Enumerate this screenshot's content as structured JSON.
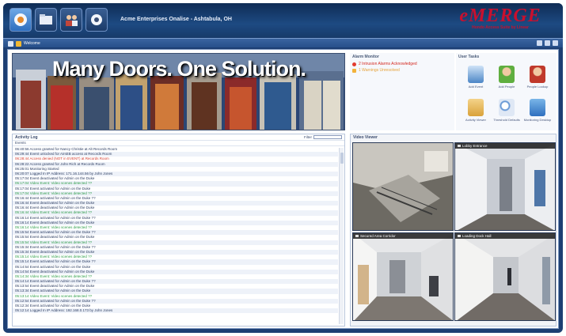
{
  "header": {
    "site_title": "Acme Enterprises Onalise - Ashtabula, OH",
    "nav_buttons": [
      {
        "name": "home-icon"
      },
      {
        "name": "folder-icon"
      },
      {
        "name": "people-icon"
      },
      {
        "name": "gear-icon"
      }
    ],
    "logo": {
      "main": "eMERGE",
      "sub": "Hondo Access Suite by Linear"
    }
  },
  "toolbar": {
    "welcome_label": "Welcome"
  },
  "banner": {
    "text": "Many Doors. One Solution."
  },
  "alarm_monitor": {
    "title": "Alarm Monitor",
    "items": [
      {
        "text": "2 Intrusion Alarms Acknowledged",
        "status": "alarm"
      },
      {
        "text": "1 Warnings Unresolved",
        "status": "warning"
      }
    ]
  },
  "user_tasks": {
    "title": "User Tasks",
    "items": [
      {
        "label": "Add Event",
        "icon": "calendar-icon"
      },
      {
        "label": "Add People",
        "icon": "add-person-icon"
      },
      {
        "label": "People Lookup",
        "icon": "person-search-icon"
      },
      {
        "label": "Activity Viewer",
        "icon": "clipboard-icon"
      },
      {
        "label": "Threshold Defaults",
        "icon": "search-icon"
      },
      {
        "label": "Monitoring Desktop",
        "icon": "monitor-icon"
      }
    ]
  },
  "activity_log": {
    "title": "Activity Log",
    "filter_label": "Filter",
    "sub_label": "Events",
    "rows": [
      {
        "text": "06:40:56 Access granted for Nancy Christie at Alt Records Room",
        "color": "normal"
      },
      {
        "text": "06:29:44 Event unlocked for AirsEB access at Records Room",
        "color": "normal"
      },
      {
        "text": "06:28:44 Access denied (NOT in EVENT) at Records Room",
        "color": "red"
      },
      {
        "text": "06:28:22 Access granted for John Rich at Records Room",
        "color": "normal"
      },
      {
        "text": "06:25:01 Monitoring Started",
        "color": "normal"
      },
      {
        "text": "06:20:07 Logged In IP Address: 171.16.144.56 by John Jones",
        "color": "normal"
      },
      {
        "text": "05:17:04 Event deactivated for Admin on the Duke",
        "color": "normal"
      },
      {
        "text": "05:17:04 Video Event: Video scenes detected ??",
        "color": "green"
      },
      {
        "text": "05:17:04 Event activated for Admin on the Duke",
        "color": "normal"
      },
      {
        "text": "05:17:04 Video Event: Video scenes detected ??",
        "color": "green"
      },
      {
        "text": "05:16:44 Event activated for Admin on the Duke ??",
        "color": "normal"
      },
      {
        "text": "05:16:44 Event deactivated for Admin on the Duke",
        "color": "normal"
      },
      {
        "text": "05:16:44 Event deactivated for Admin on the Duke",
        "color": "normal"
      },
      {
        "text": "05:16:44 Video Event: Video scenes detected ??",
        "color": "green"
      },
      {
        "text": "05:16:14 Event activated for Admin on the Duke ??",
        "color": "normal"
      },
      {
        "text": "05:16:14 Event deactivated for Admin on the Duke",
        "color": "normal"
      },
      {
        "text": "05:16:14 Video Event: Video scenes detected ??",
        "color": "green"
      },
      {
        "text": "05:15:54 Event activated for Admin on the Duke ??",
        "color": "normal"
      },
      {
        "text": "05:15:54 Event deactivated for Admin on the Duke",
        "color": "normal"
      },
      {
        "text": "05:15:54 Video Event: Video scenes detected ??",
        "color": "green"
      },
      {
        "text": "05:15:34 Event activated for Admin on the Duke ??",
        "color": "normal"
      },
      {
        "text": "05:15:34 Event deactivated for Admin on the Duke",
        "color": "normal"
      },
      {
        "text": "05:15:14 Video Event: Video scenes detected ??",
        "color": "green"
      },
      {
        "text": "05:15:14 Event activated for Admin on the Duke ??",
        "color": "normal"
      },
      {
        "text": "05:14:54 Event activated for Admin on the Duke",
        "color": "normal"
      },
      {
        "text": "05:14:54 Event deactivated for Admin on the Duke",
        "color": "normal"
      },
      {
        "text": "05:14:34 Video Event: Video scenes detected ??",
        "color": "green"
      },
      {
        "text": "05:14:14 Event activated for Admin on the Duke ??",
        "color": "normal"
      },
      {
        "text": "05:13:54 Event deactivated for Admin on the Duke",
        "color": "normal"
      },
      {
        "text": "05:13:34 Event activated for Admin on the Duke",
        "color": "normal"
      },
      {
        "text": "05:13:14 Video Event: Video scenes detected ??",
        "color": "green"
      },
      {
        "text": "05:12:54 Event activated for Admin on the Duke ??",
        "color": "normal"
      },
      {
        "text": "05:12:34 Event activated for Admin on the Duke",
        "color": "normal"
      },
      {
        "text": "05:12:14 Logged In IP Address: 192.168.0.173 by John Jones",
        "color": "normal"
      }
    ]
  },
  "video_panel": {
    "title": "Video Viewer",
    "cameras": [
      {
        "label": ""
      },
      {
        "label": "Lobby Entrance"
      },
      {
        "label": "Secured Area Corridor"
      },
      {
        "label": "Loading Dock Hall"
      }
    ]
  },
  "colors": {
    "frame": "#1d3f73",
    "alarm_red": "#d42a20",
    "warning_amber": "#e6a23a",
    "log_green": "#2f9e4a",
    "logo_red": "#c8102e"
  }
}
